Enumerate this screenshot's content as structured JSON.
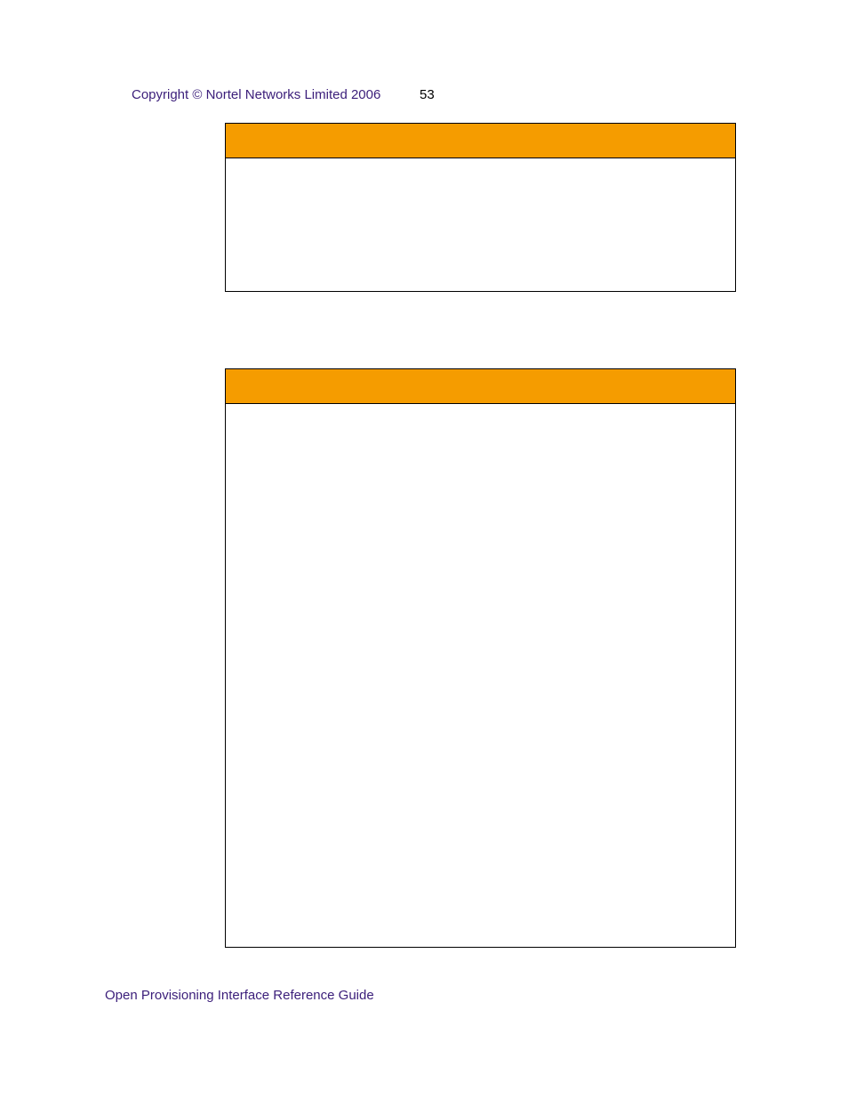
{
  "header": {
    "copyright": "Copyright © Nortel Networks Limited 2006",
    "page_number": "53"
  },
  "footer": {
    "title": "Open Provisioning Interface Reference Guide"
  },
  "boxes": {
    "box1": {
      "header_text": ""
    },
    "box2": {
      "header_text": ""
    }
  },
  "colors": {
    "accent_purple": "#3b1e7a",
    "accent_orange": "#f59c00"
  }
}
